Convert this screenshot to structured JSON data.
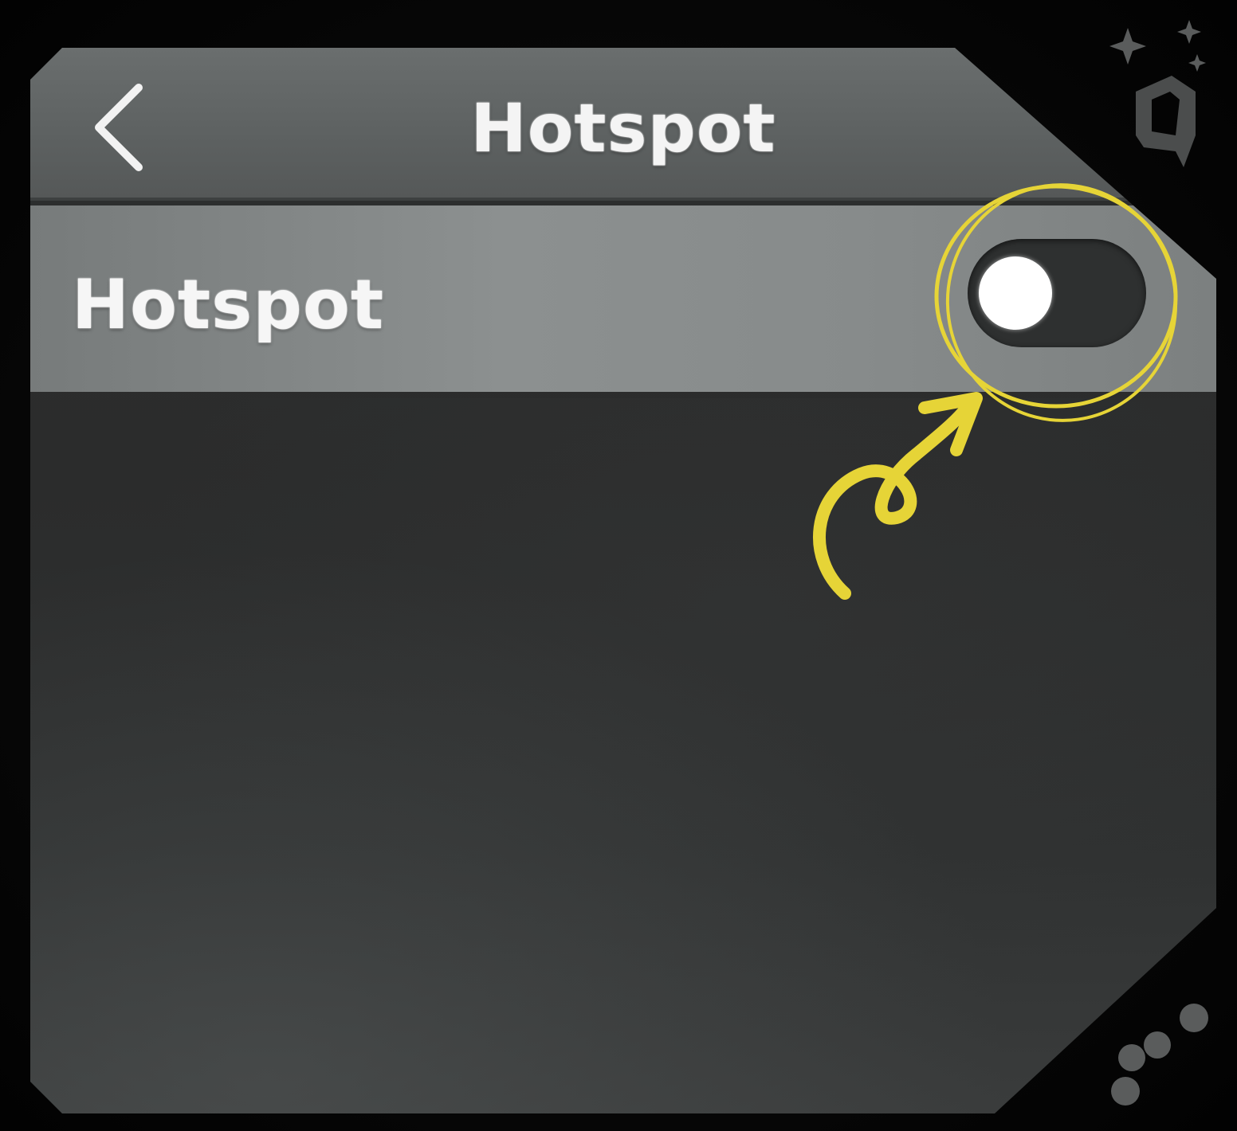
{
  "header": {
    "title": "Hotspot",
    "back_icon": "chevron-left-icon"
  },
  "settings": {
    "hotspot": {
      "label": "Hotspot",
      "enabled": false
    }
  },
  "colors": {
    "header_bg": "#5d6161",
    "row_bg": "#878b8b",
    "body_bg": "#2d2f2f",
    "toggle_track": "#2e3030",
    "toggle_knob": "#ffffff",
    "annotation": "#e9d62a"
  },
  "decorations": {
    "logo_icon": "sparkle-logo-icon",
    "annotation": "yellow-circle-and-arrow-annotation",
    "nav_dots": "dot-indicator-icon"
  }
}
